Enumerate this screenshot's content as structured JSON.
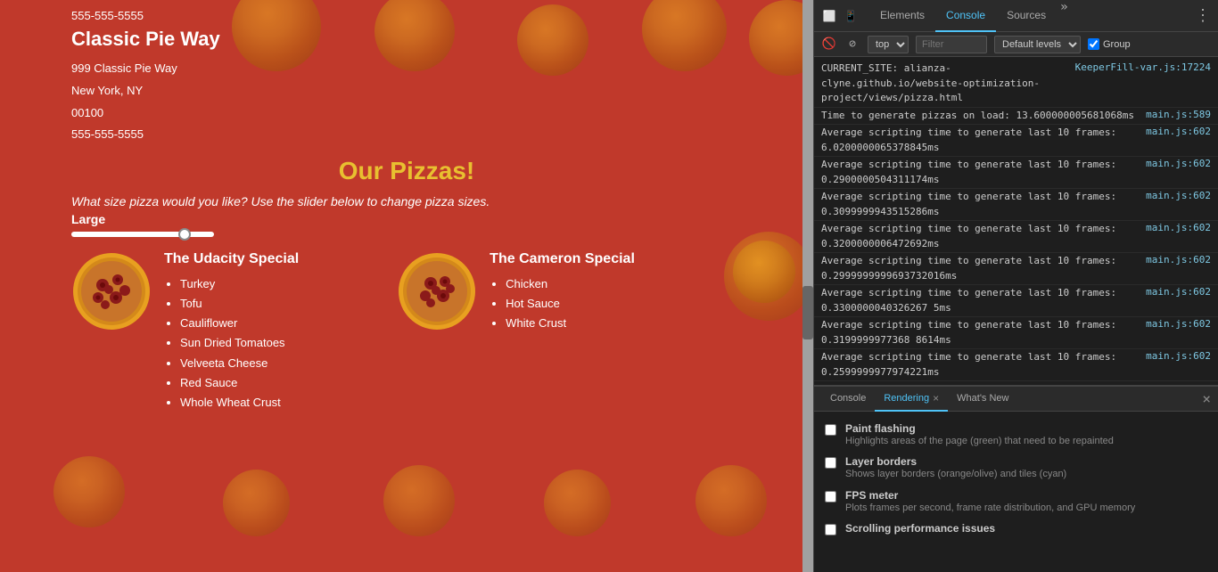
{
  "website": {
    "phone_top": "555-555-5555",
    "store_name": "Classic Pie Way",
    "address_line1": "999 Classic Pie Way",
    "address_line2": "New York, NY",
    "address_line3": "00100",
    "phone": "555-555-5555",
    "page_title": "Our Pizzas!",
    "subtitle": "What size pizza would you like? Use the slider below to change pizza sizes.",
    "size_label": "Large",
    "pizza1": {
      "title": "The Udacity Special",
      "toppings": [
        "Turkey",
        "Tofu",
        "Cauliflower",
        "Sun Dried Tomatoes",
        "Velveeta Cheese",
        "Red Sauce",
        "Whole Wheat Crust"
      ]
    },
    "pizza2": {
      "title": "The Cameron Special",
      "toppings": [
        "Chicken",
        "Hot Sauce",
        "White Crust"
      ]
    }
  },
  "devtools": {
    "tabs": [
      "Elements",
      "Console",
      "Sources"
    ],
    "active_tab": "Console",
    "more_tabs_icon": "»",
    "toolbar": {
      "filter_placeholder": "Filter",
      "levels_label": "Default levels",
      "group_label": "Group"
    },
    "context_selector": "top",
    "console_entries": [
      {
        "text": "CURRENT_SITE:  alianza-clyne.github.io/website-optimization-project/views/pizza.html",
        "link": "KeeperFill-var.js:17224"
      },
      {
        "text": "Time to generate pizzas on load: 13.600000005681068ms",
        "link": "main.js:589"
      },
      {
        "text": "Average scripting time to generate last 10 frames: 6.0200000065378845ms",
        "link": "main.js:602"
      },
      {
        "text": "Average scripting time to generate last 10 frames: 0.2900000504311174ms",
        "link": "main.js:602"
      },
      {
        "text": "Average scripting time to generate last 10 frames: 0.3099999943515286ms",
        "link": "main.js:602"
      },
      {
        "text": "Average scripting time to generate last 10 frames: 0.3200000006472692ms",
        "link": "main.js:602"
      },
      {
        "text": "Average scripting time to generate last 10 frames: 0.2999999999693732016ms",
        "link": "main.js:602"
      },
      {
        "text": "Average scripting time to generate last 10 frames: 0.3300000040326267 5ms",
        "link": "main.js:602"
      },
      {
        "text": "Average scripting time to generate last 10 frames: 0.3199999977368 8614ms",
        "link": "main.js:602"
      },
      {
        "text": "Average scripting time to generate last 10 frames: 0.2599999977974221ms",
        "link": "main.js:602"
      }
    ],
    "bottom_tabs": [
      "Console",
      "Rendering",
      "What's New"
    ],
    "active_bottom_tab": "Rendering",
    "rendering": {
      "items": [
        {
          "title": "Paint flashing",
          "desc": "Highlights areas of the page (green) that need to be repainted",
          "checked": false
        },
        {
          "title": "Layer borders",
          "desc": "Shows layer borders (orange/olive) and tiles (cyan)",
          "checked": false
        },
        {
          "title": "FPS meter",
          "desc": "Plots frames per second, frame rate distribution, and GPU memory",
          "checked": false
        },
        {
          "title": "Scrolling performance issues",
          "desc": "",
          "checked": false
        }
      ]
    }
  }
}
